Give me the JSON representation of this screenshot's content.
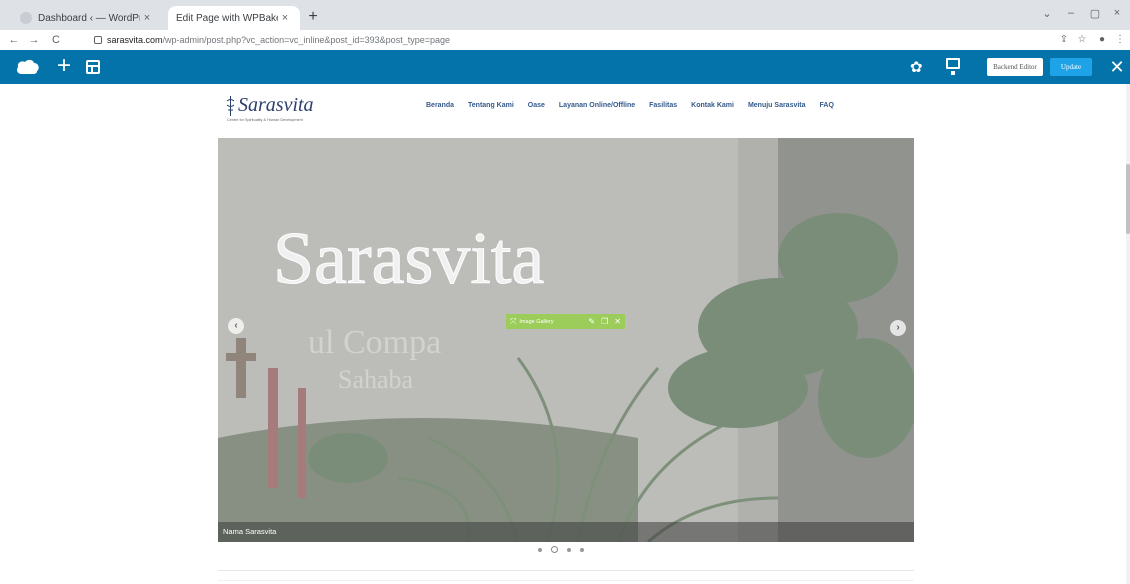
{
  "browser": {
    "tabs": [
      {
        "label": "Dashboard ‹ — WordPress",
        "close": "×"
      },
      {
        "label": "Edit Page with WPBakery Page B…",
        "close": "×"
      }
    ],
    "new_tab": "+",
    "window_controls": [
      "⌄",
      "–",
      "▢",
      "×"
    ],
    "nav": {
      "back": "←",
      "forward": "→",
      "reload": "C"
    },
    "url": {
      "domain": "sarasvita.com",
      "path": "/wp-admin/post.php?vc_action=vc_inline&post_id=393&post_type=page"
    },
    "toolbar_icons": {
      "share": "⇪",
      "star": "☆",
      "profile": "●",
      "menu": "⋮"
    }
  },
  "vc_toolbar": {
    "add": "+",
    "backend_editor_label": "Backend Editor",
    "update_label": "Update",
    "close": "✕",
    "gear": "✿"
  },
  "site": {
    "logo_text": "Sarasvita",
    "logo_tagline": "Centre for Spirituality & Human Development",
    "menu": [
      "Beranda",
      "Tentang Kami",
      "Oase",
      "Layanan Online/Offline",
      "Fasilitas",
      "Kontak Kami",
      "Menuju Sarasvita",
      "FAQ"
    ]
  },
  "gallery": {
    "caption": "Nama Sarasvita",
    "element_label": "Image Gallery",
    "prev": "‹",
    "next": "›",
    "dots_count": 4,
    "active_dot": 1,
    "sign_text": "Sarasvita",
    "sign_sub_1": "ul Compa",
    "sign_sub_2": "Sahaba"
  }
}
